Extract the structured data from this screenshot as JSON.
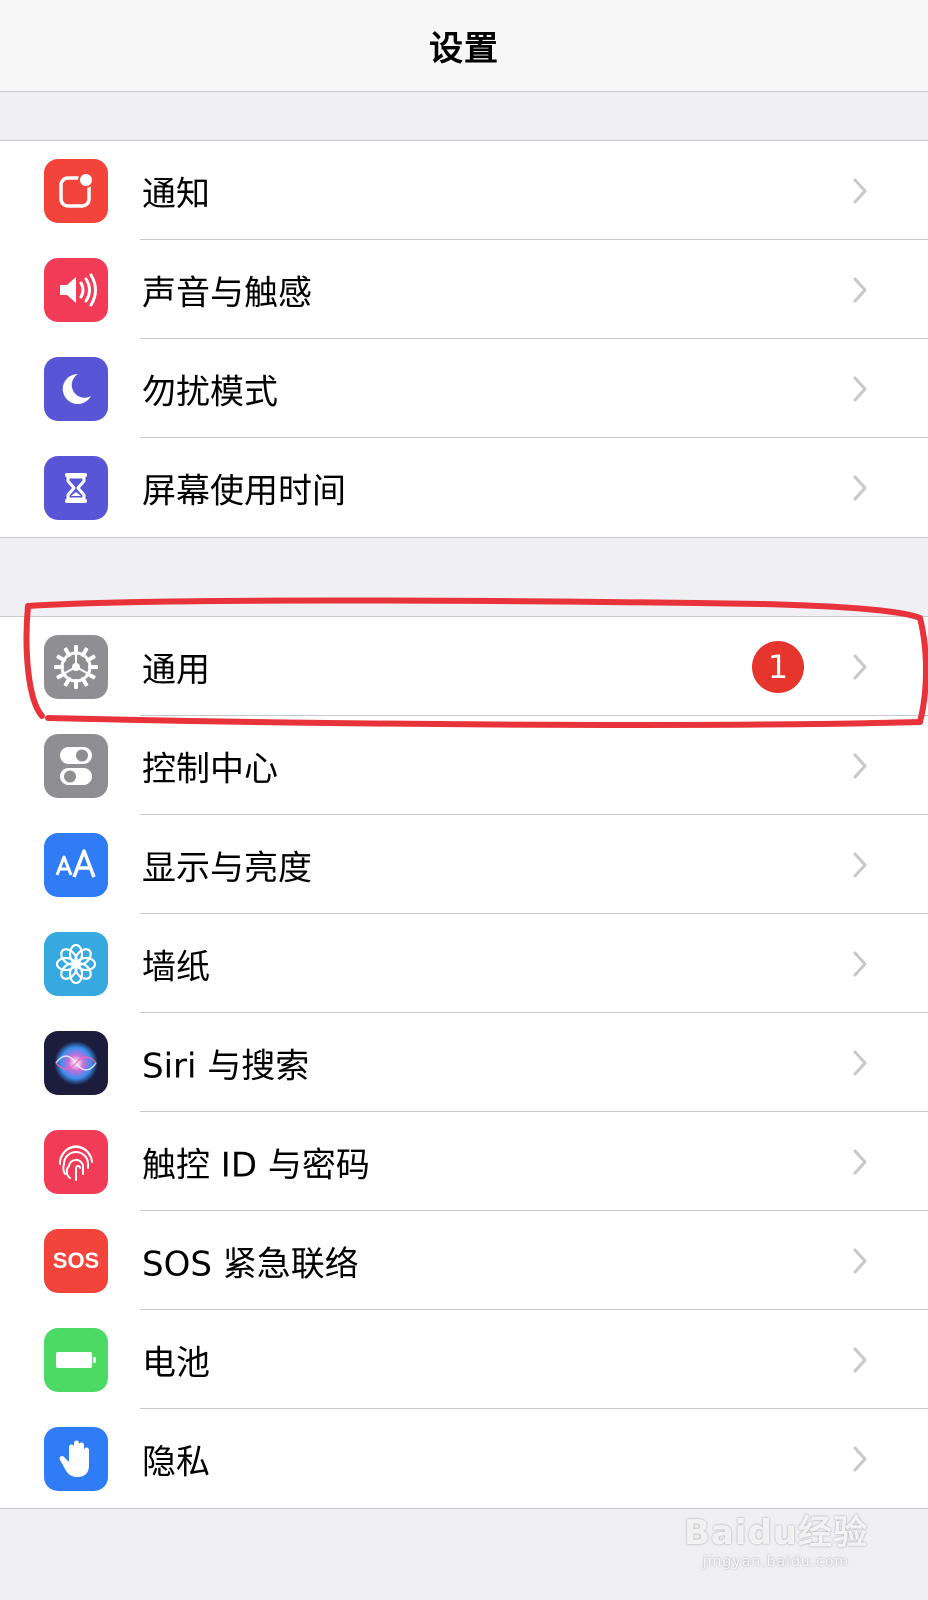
{
  "header": {
    "title": "设置"
  },
  "groups": [
    {
      "items": [
        {
          "label": "通知",
          "icon": "notifications-icon",
          "color": "#f2443a"
        },
        {
          "label": "声音与触感",
          "icon": "speaker-icon",
          "color": "#f23b57"
        },
        {
          "label": "勿扰模式",
          "icon": "moon-icon",
          "color": "#5856d6"
        },
        {
          "label": "屏幕使用时间",
          "icon": "hourglass-icon",
          "color": "#5856d6"
        }
      ]
    },
    {
      "items": [
        {
          "label": "通用",
          "icon": "gear-icon",
          "color": "#8e8e93",
          "badge": "1"
        },
        {
          "label": "控制中心",
          "icon": "toggles-icon",
          "color": "#8e8e93"
        },
        {
          "label": "显示与亮度",
          "icon": "text-size-icon",
          "color": "#2f7cf6"
        },
        {
          "label": "墙纸",
          "icon": "flower-icon",
          "color": "#36a9e1"
        },
        {
          "label": "Siri 与搜索",
          "icon": "siri-icon",
          "color": "#1c1c3c"
        },
        {
          "label": "触控 ID 与密码",
          "icon": "fingerprint-icon",
          "color": "#f23b57"
        },
        {
          "label": "SOS 紧急联络",
          "icon": "sos-icon",
          "color": "#f2443a",
          "icon_text": "SOS"
        },
        {
          "label": "电池",
          "icon": "battery-icon",
          "color": "#4cd964"
        },
        {
          "label": "隐私",
          "icon": "hand-icon",
          "color": "#2f7cf6"
        }
      ]
    }
  ],
  "watermark": {
    "brand": "Baidu经验",
    "site": "jingyan.baidu.com"
  },
  "annotation_color": "#e8333b"
}
